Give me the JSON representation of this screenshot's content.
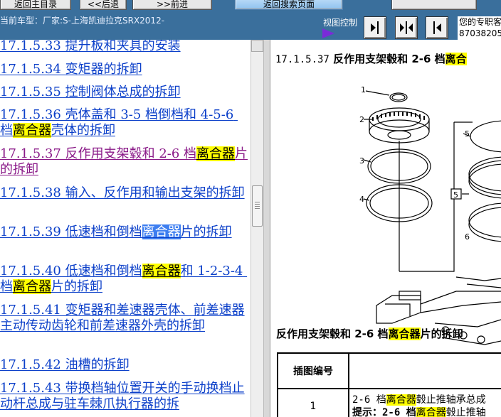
{
  "toolbar": {
    "btn_home": "返回主目录",
    "btn_prev": "<<后退",
    "btn_next": ">>前进",
    "btn_search": "返回搜索页面",
    "current_model": "当前车型：厂家:S-上海凯迪拉克SRX2012-",
    "view_control": "视图控制",
    "expert_line1": "您的专职客",
    "expert_line2": "87038205"
  },
  "toc": {
    "items": [
      {
        "pre": "17.1.5.33 提升板和夹具的安装",
        "hl": "",
        "post": ""
      },
      {
        "pre": "17.1.5.34 变矩器的拆卸",
        "hl": "",
        "post": ""
      },
      {
        "pre": "17.1.5.35 控制阀体总成的拆卸",
        "hl": "",
        "post": ""
      },
      {
        "pre": "17.1.5.36 壳体盖和 3-5 档倒档和 4-5-6 档",
        "hl": "离合器",
        "post": "壳体的拆卸"
      },
      {
        "pre": "17.1.5.37 反作用支架毂和 2-6 档",
        "hl": "离合器",
        "post": "片的拆卸"
      },
      {
        "pre": "17.1.5.38 输入、反作用和输出支架的拆卸",
        "hl": "",
        "post": ""
      },
      {
        "pre": "17.1.5.39 低速档和倒档",
        "hl": "离合器",
        "post": "片的拆卸"
      },
      {
        "pre": "17.1.5.40 低速档和倒档",
        "hl": "离合器",
        "post": "和 1-2-3-4 档",
        "hl2": "离合器",
        "post2": "片的拆卸"
      },
      {
        "pre": "17.1.5.41 变矩器和差速器壳体、前差速器主动传动齿轮和前差速器外壳的拆卸",
        "hl": "",
        "post": ""
      },
      {
        "pre": "17.1.5.42 油槽的拆卸",
        "hl": "",
        "post": ""
      },
      {
        "pre": "17.1.5.43 带换档轴位置开关的手动换档止动杆总成与驻车棘爪执行器的拆",
        "hl": "",
        "post": ""
      }
    ]
  },
  "content": {
    "heading_num": "17.1.5.37",
    "heading_text": "反作用支架毂和 2-6 档",
    "heading_hl": "离合",
    "figure_labels": [
      "1",
      "2",
      "3",
      "4",
      "5",
      "5",
      "6"
    ],
    "caption_pre": "反作用支架毂和 2-6 档",
    "caption_hl": "离合器",
    "caption_post": "片的拆卸",
    "table_header_figure": "插图编号",
    "row_num": "1",
    "row_line1_pre": "2-6 档",
    "row_line1_hl": "离合器",
    "row_line1_post": "毂止推轴承总成",
    "row_line2_pre": "提示：2-6 档",
    "row_line2_hl": "离合器",
    "row_line2_post": "毂止推轴"
  }
}
